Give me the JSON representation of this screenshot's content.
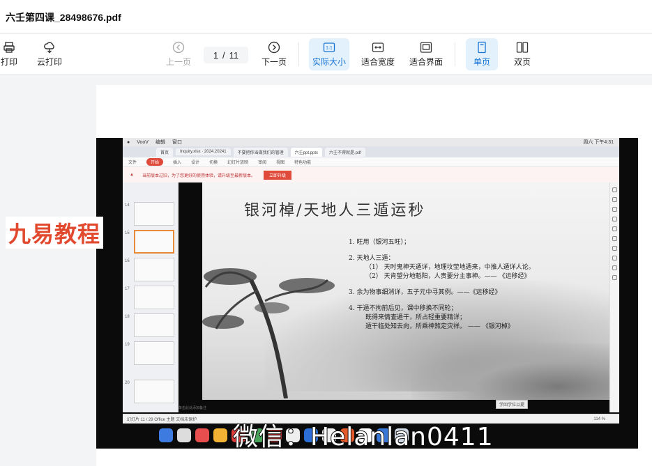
{
  "file": {
    "title": "六壬第四课_28498676.pdf"
  },
  "toolbar": {
    "print": "打印",
    "cloud_print": "云打印",
    "prev_page": "上一页",
    "current_page": "1",
    "page_sep": "/",
    "total_pages": "11",
    "next_page": "下一页",
    "actual_size": "实际大小",
    "actual_size_icon": "1:1",
    "fit_width": "适合宽度",
    "fit_page": "适合界面",
    "single_page": "单页",
    "double_page": "双页"
  },
  "brand": {
    "side_logo": "九易教程",
    "watermark": "微信：Helanlan0411"
  },
  "screenshot": {
    "mac_menu": [
      "VooV",
      "编辑",
      "窗口"
    ],
    "mac_status": "周六 下午4:31",
    "tabs": [
      "首页",
      "Inquiry.xlsx · 2024.20241",
      "不要把你当做我们的管理",
      "六壬ppt.pptx",
      "六壬不得就是.pdf"
    ],
    "ribbon": [
      "文件",
      "开始",
      "插入",
      "设计",
      "切换",
      "幻灯片放映",
      "审阅",
      "视图",
      "特色功能"
    ],
    "ribbon_start": "开始",
    "notice": "当前版本过旧，为了您更好的使用体验，请升级至最新版本。",
    "notice_button": "立即升级",
    "thumb_numbers": [
      "14",
      "15",
      "16",
      "17",
      "18",
      "19",
      "20"
    ],
    "slide_title": "银河棹/天地人三遁运秒",
    "slide_lines": [
      "1.  旺用（银河五旺）；",
      "2.  天地人三遁：",
      "（1） 天时鬼神天遁详，地理坟茔地遁来，中推人遁详人论。",
      "（2） 天肯望分地魁阳，人贵要分主事神。—— 《运移经》",
      "3.  余为物事细消详，五子元中寻其例。——《运移经》",
      "4.  干遁不拘前后见，课中移换不同轮；",
      "既得来情查遁干，所占轻重要精详；",
      "遁干临处知去向，所乘神煞定灾祥。 ——   《银河棹》"
    ],
    "slide_button": "学回学位以提",
    "notes_hint": "单击此处添加备注",
    "status_text": "幻灯片 11 / 29    Office 主题    文档未保护",
    "zoom": "114 %"
  }
}
